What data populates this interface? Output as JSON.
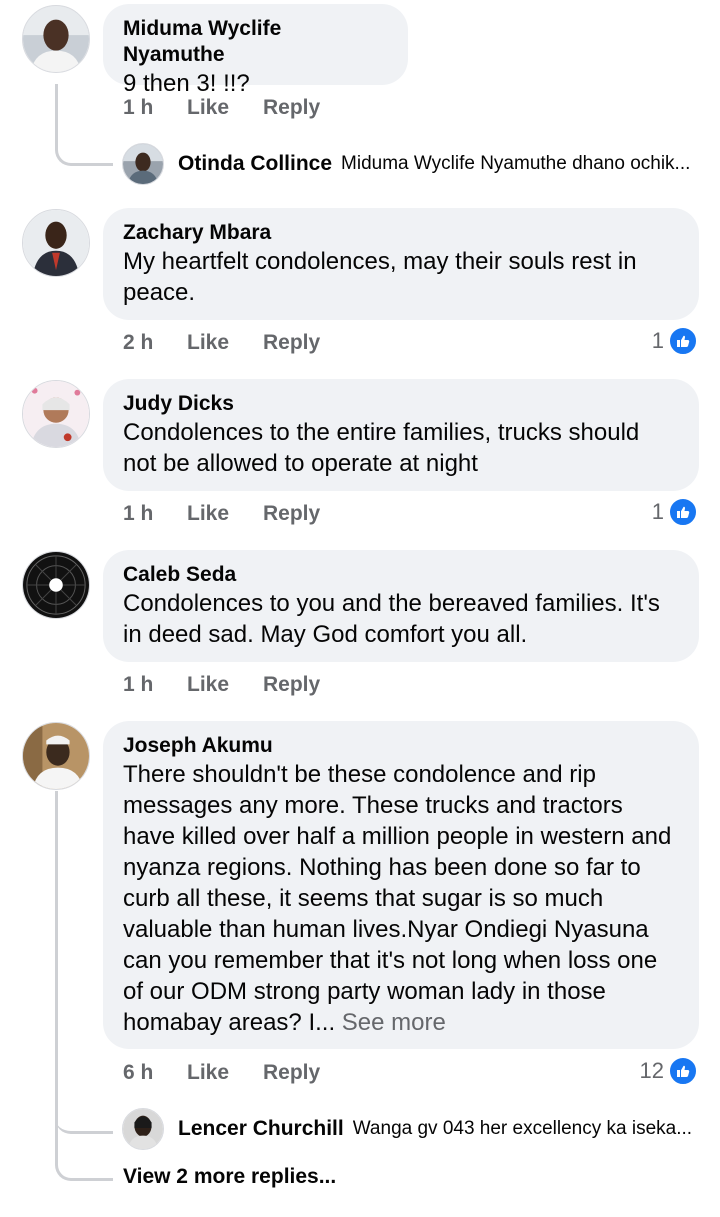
{
  "comments": [
    {
      "author": "Miduma Wyclife Nyamuthe",
      "text": "9 then 3! !!?",
      "time": "1 h",
      "like_label": "Like",
      "reply_label": "Reply",
      "reply_preview": {
        "author": "Otinda Collince",
        "text": "Miduma Wyclife Nyamuthe dhano ochik..."
      }
    },
    {
      "author": "Zachary Mbara",
      "text": "My heartfelt condolences, may their souls rest in peace.",
      "time": "2 h",
      "like_label": "Like",
      "reply_label": "Reply",
      "reaction_count": "1"
    },
    {
      "author": "Judy Dicks",
      "text": "Condolences to the entire families, trucks should not be allowed to operate at night",
      "time": "1 h",
      "like_label": "Like",
      "reply_label": "Reply",
      "reaction_count": "1"
    },
    {
      "author": "Caleb Seda",
      "text": "Condolences to you and the bereaved families. It's in deed sad. May God comfort you all.",
      "time": "1 h",
      "like_label": "Like",
      "reply_label": "Reply"
    },
    {
      "author": "Joseph Akumu",
      "text": "There  shouldn't be these condolence  and rip messages any more. These trucks  and tractors have killed over half a million people in western and nyanza regions. Nothing has been done so far to curb all these, it seems that sugar is so much valuable than human lives.Nyar Ondiegi Nyasuna can you remember that it's not long when loss one of our ODM strong party woman  lady in those homabay areas? I...",
      "see_more": "See more",
      "time": "6 h",
      "like_label": "Like",
      "reply_label": "Reply",
      "reaction_count": "12",
      "reply_preview": {
        "author": "Lencer Churchill",
        "text": "Wanga gv 043  her excellency  ka iseka..."
      },
      "view_more_replies": "View 2 more replies..."
    }
  ],
  "icons": {
    "reaction": "like-thumb-icon"
  },
  "colors": {
    "bubble": "#f0f2f5",
    "like_blue": "#1877f2",
    "meta_gray": "#65676b"
  }
}
